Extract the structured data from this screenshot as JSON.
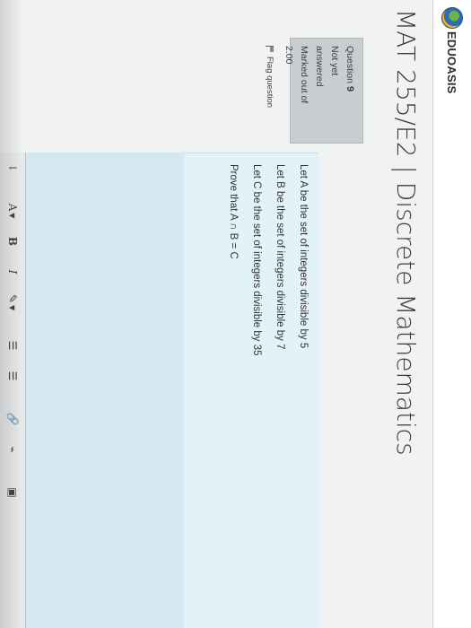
{
  "brand": {
    "logo_text": "EDUOASIS",
    "logo_icon": "eduoasis-logo-icon"
  },
  "course": {
    "title": "MAT 255/E2 | Discrete Mathematics"
  },
  "question_info": {
    "question_label": "Question",
    "question_number": "9",
    "status_line1": "Not yet",
    "status_line2": "answered",
    "marked_line": "Marked out of",
    "marks": "2.00",
    "flag_label": "Flag question",
    "flag_icon": "flag-icon"
  },
  "question": {
    "lines": [
      "Let A be the set of integers divisible by 5",
      "Let B be the set of integers divisible by 7",
      "Let C be the set of integers divisible by 35",
      "Prove that A ∩ B = C"
    ]
  },
  "editor": {
    "toolbar": {
      "items": [
        {
          "name": "toolbar-toggle-button",
          "glyph": "⇂",
          "icon": "toolbar-toggle-icon"
        },
        {
          "name": "paragraph-style-button",
          "glyph": "A",
          "icon": "font-style-icon"
        },
        {
          "name": "bold-button",
          "glyph": "B",
          "icon": "bold-icon"
        },
        {
          "name": "italic-button",
          "glyph": "I",
          "icon": "italic-icon"
        },
        {
          "name": "highlight-button",
          "glyph": "✎",
          "icon": "pen-icon"
        },
        {
          "name": "unordered-list-button",
          "glyph": "☰",
          "icon": "bullet-list-icon"
        },
        {
          "name": "ordered-list-button",
          "glyph": "☰",
          "icon": "numbered-list-icon"
        },
        {
          "name": "link-button",
          "glyph": "🔗",
          "icon": "link-icon"
        },
        {
          "name": "unlink-button",
          "glyph": "⌁",
          "icon": "unlink-icon"
        },
        {
          "name": "image-button",
          "glyph": "▣",
          "icon": "image-icon"
        }
      ]
    }
  },
  "colors": {
    "question_bg": "#e3f1f8",
    "editor_bg": "#d4e8f3",
    "info_bg": "#c9ccd0"
  }
}
